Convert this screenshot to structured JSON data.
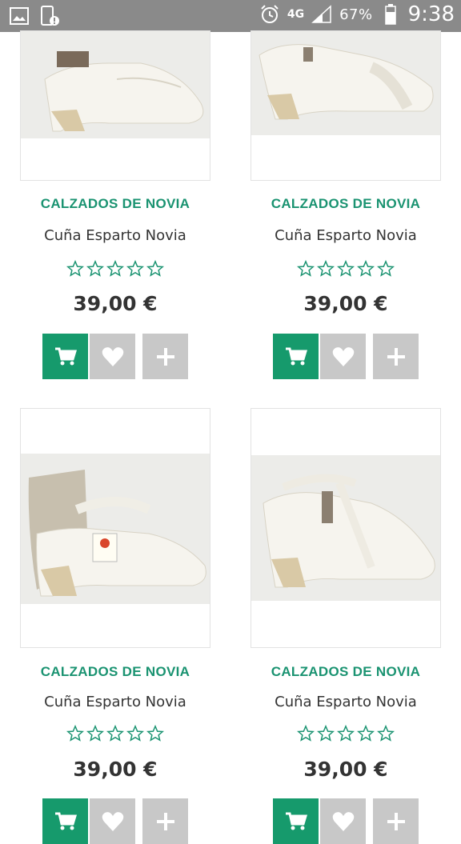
{
  "status_bar": {
    "network": "4G",
    "battery": "67%",
    "time": "9:38",
    "icons": [
      "gallery-icon",
      "phone-alert-icon",
      "alarm-icon",
      "signal-icon",
      "battery-icon"
    ]
  },
  "products": [
    {
      "brand": "CALZADOS DE NOVIA",
      "name": "Cuña Esparto Novia",
      "price": "39,00 €",
      "rating": 0
    },
    {
      "brand": "CALZADOS DE NOVIA",
      "name": "Cuña Esparto Novia",
      "price": "39,00 €",
      "rating": 0
    },
    {
      "brand": "CALZADOS DE NOVIA",
      "name": "Cuña Esparto Novia",
      "price": "39,00 €",
      "rating": 0
    },
    {
      "brand": "CALZADOS DE NOVIA",
      "name": "Cuña Esparto Novia",
      "price": "39,00 €",
      "rating": 0
    }
  ],
  "colors": {
    "accent": "#169a6c",
    "brand_text": "#1a9371",
    "button_gray": "#c8c8c8",
    "status_bar": "#8a8a8a"
  }
}
